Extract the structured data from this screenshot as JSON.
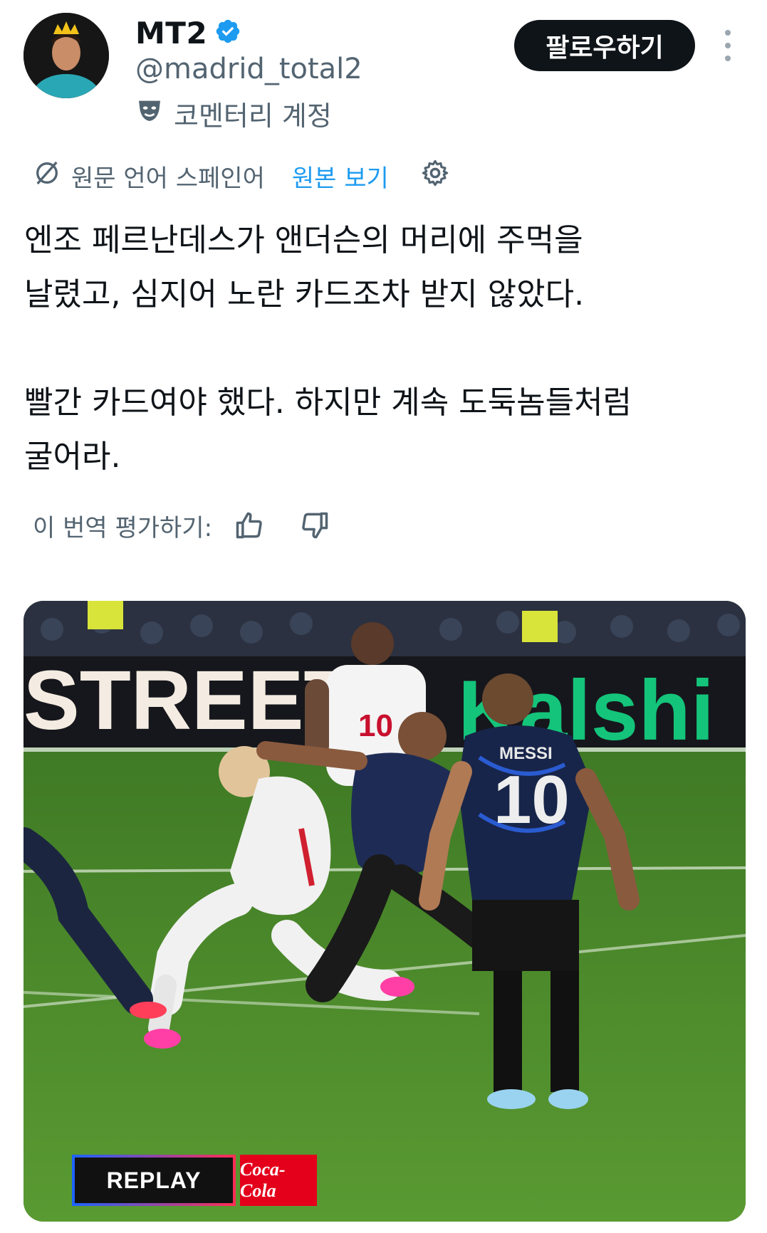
{
  "user": {
    "name": "MT2",
    "handle": "@madrid_total2",
    "account_label": "코멘터리 계정",
    "follow_label": "팔로우하기"
  },
  "translation": {
    "notice": "원문 언어 스페인어",
    "show_original": "원본 보기"
  },
  "tweet": {
    "text": "엔조 페르난데스가 앤더슨의 머리에 주먹을\n날렸고, 심지어 노란 카드조차 받지 않았다.\n\n빨간 카드여야 했다. 하지만 계속 도둑놈들처럼\n굴어라."
  },
  "rating": {
    "label": "이 번역 평가하기:"
  },
  "media": {
    "ad_board_left": "STREET",
    "ad_board_right": "Kalshi",
    "player_name": "MESSI",
    "player_number": "10",
    "opponent_number": "10",
    "replay_label": "REPLAY",
    "sponsor": "Coca-Cola"
  },
  "colors": {
    "accent": "#1d9bf0",
    "text_secondary": "#536471",
    "verified": "#1d9bf0"
  },
  "icons": [
    "more-icon",
    "verified-icon",
    "commentary-mask-icon",
    "translate-icon",
    "settings-icon",
    "thumbs-up-icon",
    "thumbs-down-icon"
  ]
}
